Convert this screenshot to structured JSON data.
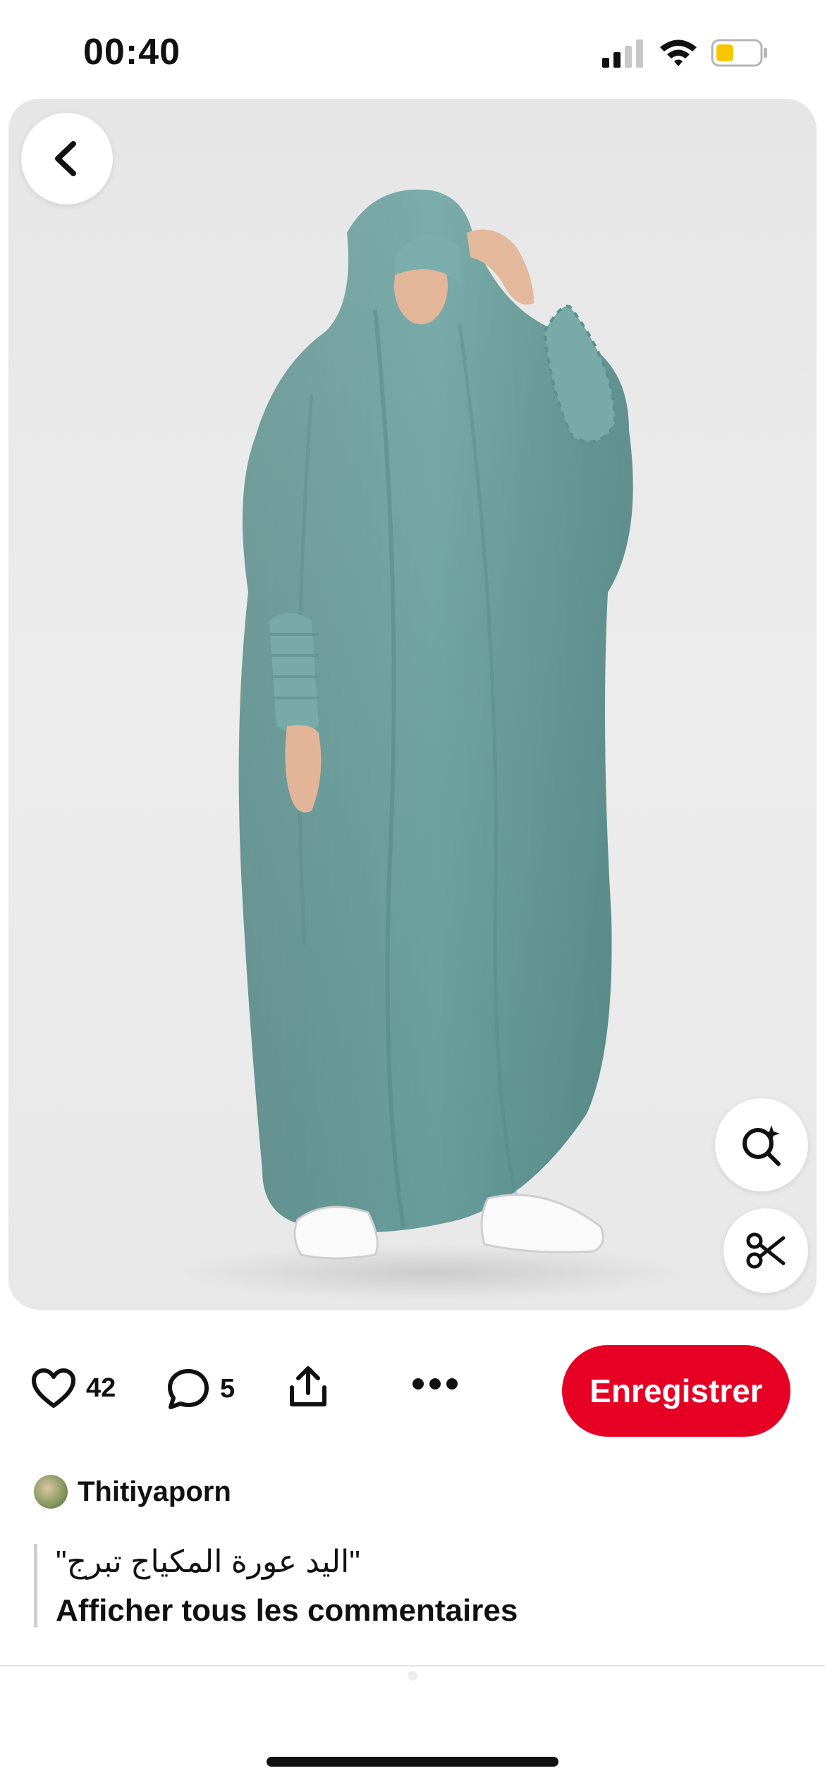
{
  "status_bar": {
    "time": "00:40",
    "signal_icon": "cellular-signal-icon",
    "wifi_icon": "wifi-icon",
    "battery_icon": "battery-icon",
    "battery_color": "#f7c600"
  },
  "pin": {
    "back_icon": "chevron-left-icon",
    "visual_search_icon": "sparkle-search-icon",
    "cutout_icon": "scissors-icon"
  },
  "actions": {
    "like_count": "42",
    "comment_count": "5",
    "share_icon": "share-icon",
    "more_icon": "more-dots-icon",
    "save_label": "Enregistrer",
    "save_color": "#e60023"
  },
  "author": {
    "name": "Thitiyaporn"
  },
  "comments": {
    "top_comment": "\"اليد عورة المكياج تبرج\"",
    "see_all_label": "Afficher tous les commentaires"
  }
}
